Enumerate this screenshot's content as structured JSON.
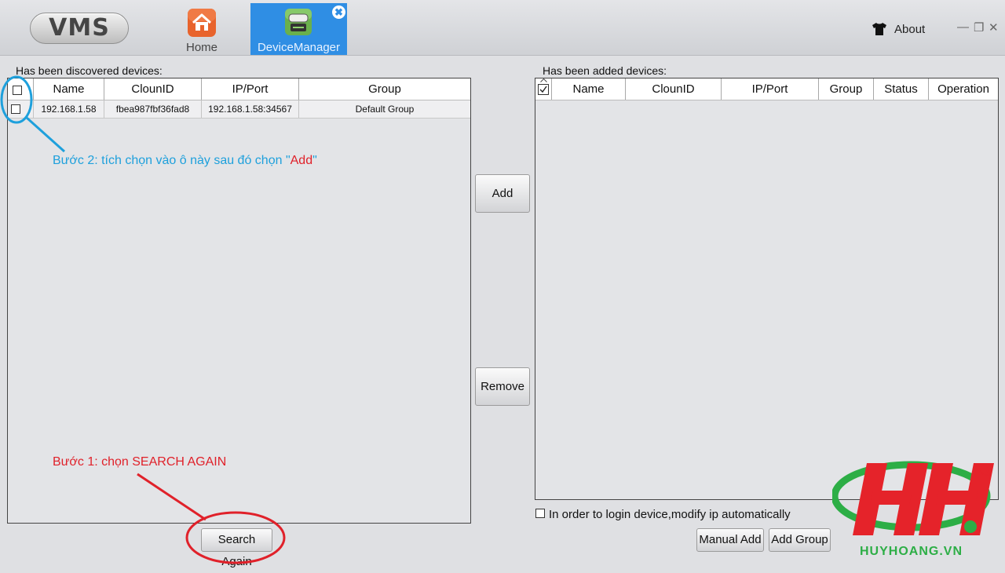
{
  "app": {
    "logo_text": "VMS"
  },
  "nav": {
    "home_label": "Home",
    "device_manager_label": "DeviceManager",
    "close_glyph": "✖"
  },
  "window": {
    "about_label": "About",
    "minimize": "—",
    "restore": "❐",
    "close": "✕"
  },
  "discovered": {
    "title": "Has been discovered devices:",
    "columns": [
      "Name",
      "ClounID",
      "IP/Port",
      "Group"
    ],
    "rows": [
      {
        "name": "192.168.1.58",
        "cloud_id": "fbea987fbf36fad8",
        "ip_port": "192.168.1.58:34567",
        "group": "Default Group",
        "checked": false
      }
    ],
    "search_again_label": "Search Again"
  },
  "added": {
    "title": "Has been added devices:",
    "columns": [
      "Name",
      "ClounID",
      "IP/Port",
      "Group",
      "Status",
      "Operation"
    ],
    "rows": [],
    "auto_ip_label": "In order to login device,modify ip automatically",
    "manual_add_label": "Manual Add",
    "add_group_label": "Add Group"
  },
  "middle": {
    "add_label": "Add",
    "remove_label": "Remove"
  },
  "annotations": {
    "step2_prefix": "Bước 2: tích chọn vào ô này sau đó chọn \"",
    "step2_word": "Add",
    "step2_suffix": "\"",
    "step1": "Bước 1: chọn SEARCH AGAIN"
  },
  "watermark": {
    "brand_text": "HUYHOANG.VN",
    "registered": "®",
    "logo_letters": "HH"
  },
  "colors": {
    "accent_tab": "#2f8ee4",
    "annot_blue": "#1ea0dc",
    "annot_red": "#e0212a",
    "brand_green": "#2dae46"
  }
}
